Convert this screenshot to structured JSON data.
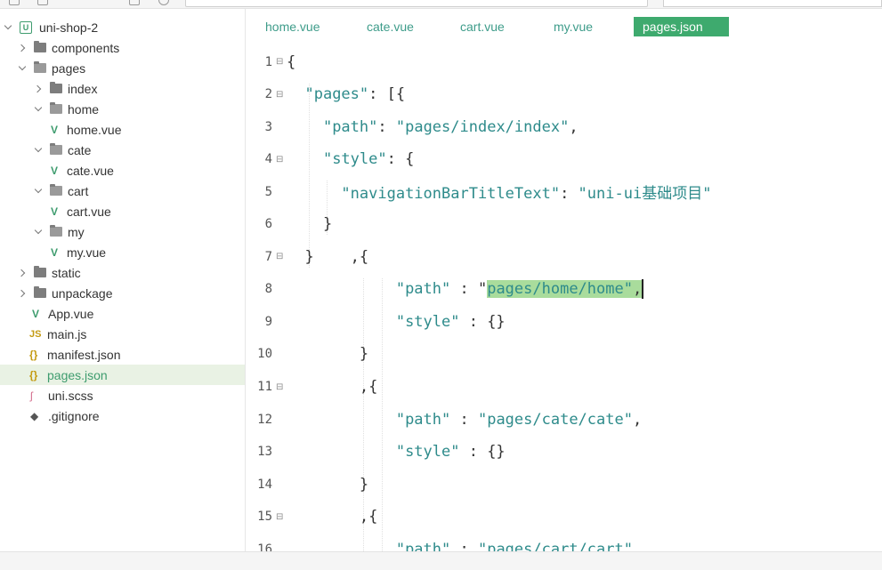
{
  "sidebar": {
    "items": [
      {
        "label": "uni-shop-2",
        "type": "project",
        "depth": 0,
        "expanded": true
      },
      {
        "label": "components",
        "type": "folder",
        "depth": 1,
        "expanded": false
      },
      {
        "label": "pages",
        "type": "folder",
        "depth": 1,
        "expanded": true
      },
      {
        "label": "index",
        "type": "folder",
        "depth": 2,
        "expanded": false
      },
      {
        "label": "home",
        "type": "folder",
        "depth": 2,
        "expanded": true
      },
      {
        "label": "home.vue",
        "type": "vue",
        "depth": 3
      },
      {
        "label": "cate",
        "type": "folder",
        "depth": 2,
        "expanded": true
      },
      {
        "label": "cate.vue",
        "type": "vue",
        "depth": 3
      },
      {
        "label": "cart",
        "type": "folder",
        "depth": 2,
        "expanded": true
      },
      {
        "label": "cart.vue",
        "type": "vue",
        "depth": 3
      },
      {
        "label": "my",
        "type": "folder",
        "depth": 2,
        "expanded": true
      },
      {
        "label": "my.vue",
        "type": "vue",
        "depth": 3
      },
      {
        "label": "static",
        "type": "folder",
        "depth": 1,
        "expanded": false
      },
      {
        "label": "unpackage",
        "type": "folder",
        "depth": 1,
        "expanded": false
      },
      {
        "label": "App.vue",
        "type": "vue",
        "depth": 1
      },
      {
        "label": "main.js",
        "type": "js",
        "depth": 1
      },
      {
        "label": "manifest.json",
        "type": "json",
        "depth": 1
      },
      {
        "label": "pages.json",
        "type": "json",
        "depth": 1,
        "active": true
      },
      {
        "label": "uni.scss",
        "type": "scss",
        "depth": 1
      },
      {
        "label": ".gitignore",
        "type": "git",
        "depth": 1
      }
    ]
  },
  "tabs": [
    {
      "label": "home.vue"
    },
    {
      "label": "cate.vue"
    },
    {
      "label": "cart.vue"
    },
    {
      "label": "my.vue"
    },
    {
      "label": "pages.json",
      "active": true
    }
  ],
  "editor": {
    "lines": [
      {
        "num": "1",
        "fold": true,
        "text": "{"
      },
      {
        "num": "2",
        "fold": true,
        "text": "  \"pages\": [{"
      },
      {
        "num": "3",
        "fold": false,
        "text": "    \"path\": \"pages/index/index\","
      },
      {
        "num": "4",
        "fold": true,
        "text": "    \"style\": {"
      },
      {
        "num": "5",
        "fold": false,
        "text": "      \"navigationBarTitleText\": \"uni-ui基础项目\""
      },
      {
        "num": "6",
        "fold": false,
        "text": "    }"
      },
      {
        "num": "7",
        "fold": true,
        "text": "  }    ,{"
      },
      {
        "num": "8",
        "fold": false,
        "text": "            \"path\" : \"pages/home/home\","
      },
      {
        "num": "9",
        "fold": false,
        "text": "            \"style\" : {}"
      },
      {
        "num": "10",
        "fold": false,
        "text": "        }"
      },
      {
        "num": "11",
        "fold": true,
        "text": "        ,{"
      },
      {
        "num": "12",
        "fold": false,
        "text": "            \"path\" : \"pages/cate/cate\","
      },
      {
        "num": "13",
        "fold": false,
        "text": "            \"style\" : {}"
      },
      {
        "num": "14",
        "fold": false,
        "text": "        }"
      },
      {
        "num": "15",
        "fold": true,
        "text": "        ,{"
      },
      {
        "num": "16",
        "fold": false,
        "text": "            \"path\" : \"pages/cart/cart\","
      }
    ]
  },
  "colors": {
    "accent": "#3eaa6e",
    "key": "#2e8b8b",
    "selection": "#a9dc9c"
  }
}
